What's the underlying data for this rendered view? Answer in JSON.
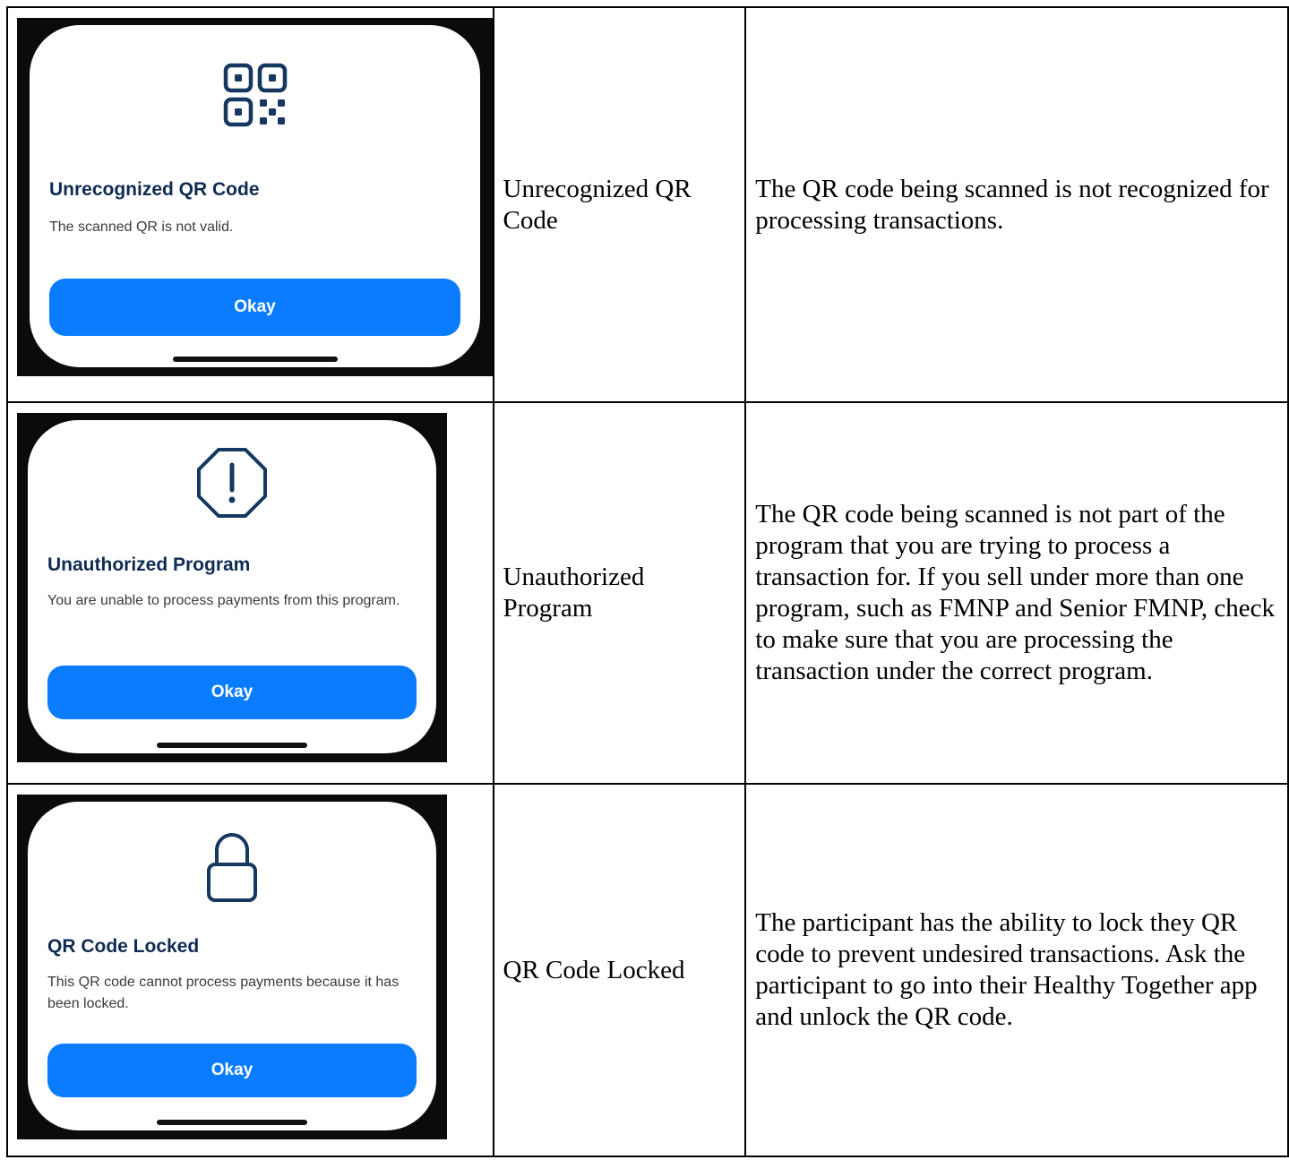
{
  "rows": [
    {
      "modal": {
        "icon": "qr-code-icon",
        "title": "Unrecognized QR Code",
        "message": "The scanned QR is not valid.",
        "button_label": "Okay"
      },
      "name": "Unrecognized QR Code",
      "description": "The QR code being scanned is not recognized for processing transactions."
    },
    {
      "modal": {
        "icon": "warning-octagon-icon",
        "title": "Unauthorized Program",
        "message": "You are unable to process payments from this program.",
        "button_label": "Okay"
      },
      "name": "Unauthorized Program",
      "description": "The QR code being scanned is not part of the program that you are trying to process a transaction for. If you sell under more than one program, such as FMNP and Senior FMNP, check to make sure that you are processing the transaction under the correct program."
    },
    {
      "modal": {
        "icon": "lock-icon",
        "title": "QR Code Locked",
        "message": "This QR code cannot process payments because it has been locked.",
        "button_label": "Okay"
      },
      "name": "QR Code Locked",
      "description": "The participant has the ability to lock they QR code to prevent undesired transactions. Ask the participant to go into their Healthy Together app and unlock the QR code."
    }
  ],
  "colors": {
    "title": "#0f2b52",
    "button": "#0a7cff",
    "icon_stroke": "#16375f",
    "phone_frame": "#0b0b0b"
  }
}
